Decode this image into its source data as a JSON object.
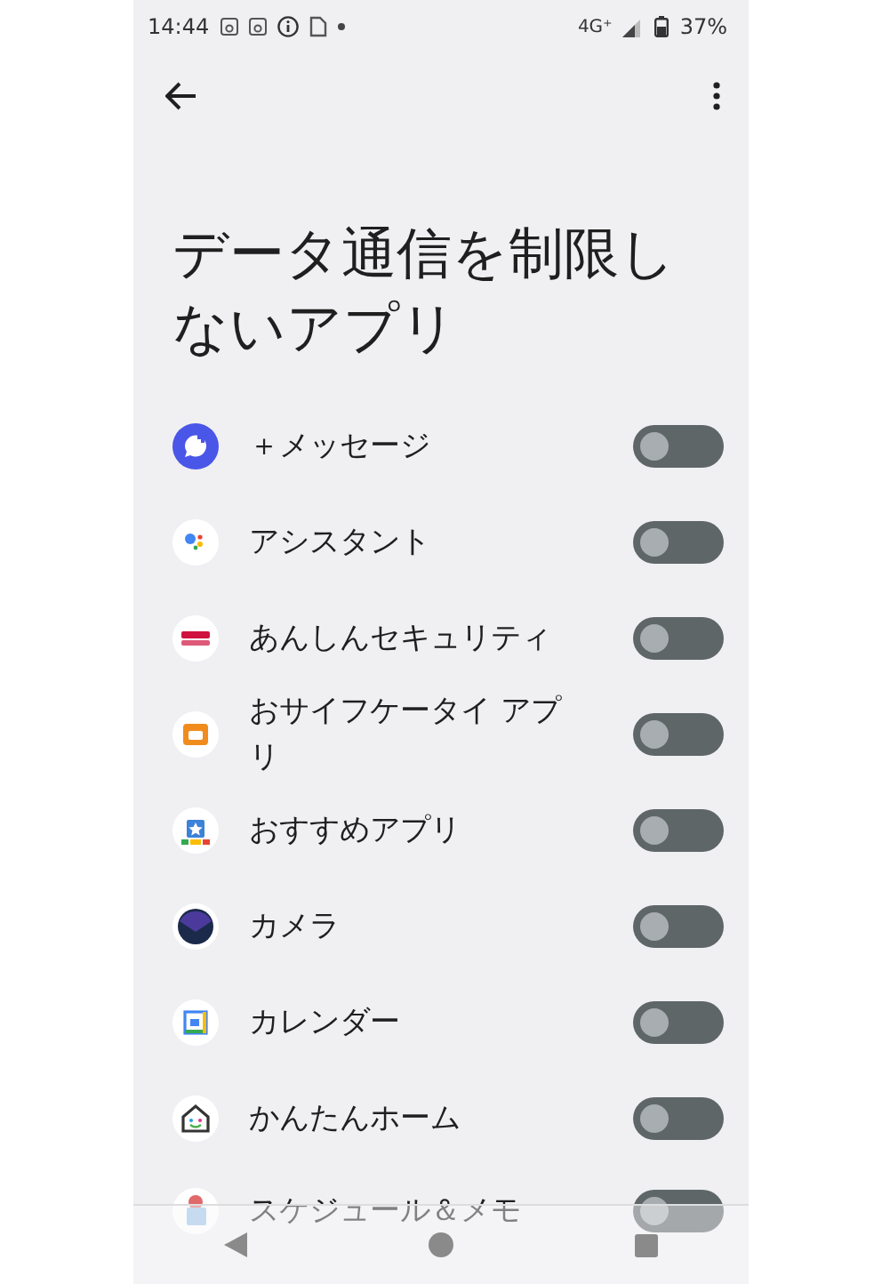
{
  "status_bar": {
    "time": "14:44",
    "network": "4G⁺",
    "battery": "37%"
  },
  "title": "データ通信を制限しないアプリ",
  "apps": [
    {
      "name": "＋メッセージ",
      "on": false
    },
    {
      "name": "アシスタント",
      "on": false
    },
    {
      "name": "あんしんセキュリティ",
      "on": false
    },
    {
      "name": "おサイフケータイ アプリ",
      "on": false
    },
    {
      "name": "おすすめアプリ",
      "on": false
    },
    {
      "name": "カメラ",
      "on": false
    },
    {
      "name": "カレンダー",
      "on": false
    },
    {
      "name": "かんたんホーム",
      "on": false
    },
    {
      "name": "スケジュール＆メモ",
      "on": false
    }
  ]
}
